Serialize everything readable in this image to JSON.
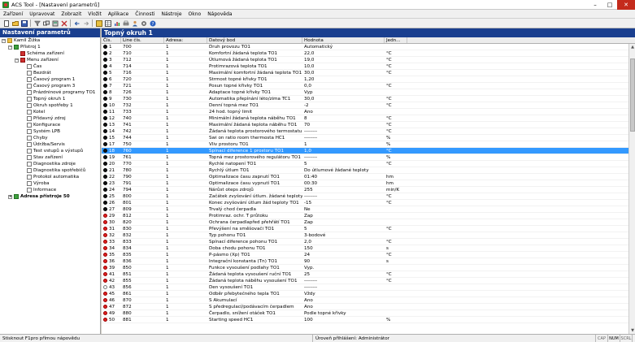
{
  "window": {
    "title": "ACS Tool - [Nastavení parametrů]",
    "minimize": "–",
    "maximize": "□",
    "close": "✕"
  },
  "menu": [
    "Zařízení",
    "Upravovat",
    "Zobrazit",
    "Vložit",
    "Aplikace",
    "Činnosti",
    "Nástroje",
    "Okno",
    "Nápověda"
  ],
  "left": {
    "header": "Nastavení parametrů",
    "tree": [
      {
        "label": "Kamil Žižka",
        "level": 0,
        "expander": "−",
        "icon": "folder"
      },
      {
        "label": "Přístroj 1",
        "level": 1,
        "expander": "−",
        "icon": "green"
      },
      {
        "label": "Schéma zařízení",
        "level": 2,
        "expander": "",
        "icon": "red"
      },
      {
        "label": "Menu zařízení",
        "level": 2,
        "expander": "−",
        "icon": "red"
      },
      {
        "label": "Čas",
        "level": 3,
        "expander": "",
        "icon": "white"
      },
      {
        "label": "Bezdrát",
        "level": 3,
        "expander": "",
        "icon": "white"
      },
      {
        "label": "Časový program 1",
        "level": 3,
        "expander": "",
        "icon": "white"
      },
      {
        "label": "Časový program 3",
        "level": 3,
        "expander": "",
        "icon": "white"
      },
      {
        "label": "Prázdninové programy TO1",
        "level": 3,
        "expander": "",
        "icon": "white"
      },
      {
        "label": "Topný okruh 1",
        "level": 3,
        "expander": "",
        "icon": "white"
      },
      {
        "label": "Okruh spotřeby 1",
        "level": 3,
        "expander": "",
        "icon": "white"
      },
      {
        "label": "Kotel",
        "level": 3,
        "expander": "",
        "icon": "white"
      },
      {
        "label": "Přídavný zdroj",
        "level": 3,
        "expander": "",
        "icon": "white"
      },
      {
        "label": "Konfigurace",
        "level": 3,
        "expander": "",
        "icon": "white"
      },
      {
        "label": "Systém LPB",
        "level": 3,
        "expander": "",
        "icon": "white"
      },
      {
        "label": "Chyby",
        "level": 3,
        "expander": "",
        "icon": "white"
      },
      {
        "label": "Údržba/Servis",
        "level": 3,
        "expander": "",
        "icon": "white"
      },
      {
        "label": "Test vstupů a výstupů",
        "level": 3,
        "expander": "",
        "icon": "white"
      },
      {
        "label": "Stav zařízení",
        "level": 3,
        "expander": "",
        "icon": "white"
      },
      {
        "label": "Diagnostika zdroje",
        "level": 3,
        "expander": "",
        "icon": "white"
      },
      {
        "label": "Diagnostika spotřebičů",
        "level": 3,
        "expander": "",
        "icon": "white"
      },
      {
        "label": "Protokol automatika",
        "level": 3,
        "expander": "",
        "icon": "white"
      },
      {
        "label": "Výroba",
        "level": 3,
        "expander": "",
        "icon": "white"
      },
      {
        "label": "Informace",
        "level": 3,
        "expander": "",
        "icon": "white"
      },
      {
        "label": "Adresa přístroje 50",
        "level": 1,
        "expander": "+",
        "icon": "green",
        "bold": true
      }
    ]
  },
  "right": {
    "header": "Topný okruh 1",
    "columns": [
      "Čís.",
      "Line čís.",
      "Adresa:",
      "Datový bod",
      "Hodnota",
      "Jedn..."
    ],
    "rows": [
      {
        "n": "1",
        "line": "700",
        "addr": "1",
        "name": "Druh provozu TO1",
        "value": "Automatický",
        "unit": "",
        "dot": "black"
      },
      {
        "n": "2",
        "line": "710",
        "addr": "1",
        "name": "Komfortní žádaná teplota TO1",
        "value": "22,0",
        "unit": "°C",
        "dot": "black"
      },
      {
        "n": "3",
        "line": "712",
        "addr": "1",
        "name": "Útlumová žádaná teplota TO1",
        "value": "19,0",
        "unit": "°C",
        "dot": "black"
      },
      {
        "n": "4",
        "line": "714",
        "addr": "1",
        "name": "Protimrazová teplota TO1",
        "value": "10,0",
        "unit": "°C",
        "dot": "black"
      },
      {
        "n": "5",
        "line": "716",
        "addr": "1",
        "name": "Maximální komfortní žádaná teplota TO1",
        "value": "30,0",
        "unit": "°C",
        "dot": "black"
      },
      {
        "n": "6",
        "line": "720",
        "addr": "1",
        "name": "Strmost topné křivky TO1",
        "value": "1,20",
        "unit": "",
        "dot": "black"
      },
      {
        "n": "7",
        "line": "721",
        "addr": "1",
        "name": "Posun topné křivky TO1",
        "value": "0,0",
        "unit": "°C",
        "dot": "black"
      },
      {
        "n": "8",
        "line": "726",
        "addr": "1",
        "name": "Adaptace topné křivky TO1",
        "value": "Vyp",
        "unit": "",
        "dot": "black"
      },
      {
        "n": "9",
        "line": "730",
        "addr": "1",
        "name": "Automatika přepínání léto/zima TC1",
        "value": "30,0",
        "unit": "°C",
        "dot": "black"
      },
      {
        "n": "10",
        "line": "732",
        "addr": "1",
        "name": "Denní topná mez TO1",
        "value": "-2",
        "unit": "°C",
        "dot": "black"
      },
      {
        "n": "11",
        "line": "733",
        "addr": "1",
        "name": "24 hod. topný limit",
        "value": "Ano",
        "unit": "",
        "dot": "black"
      },
      {
        "n": "12",
        "line": "740",
        "addr": "1",
        "name": "Minimální žádaná teplota náběhu TO1",
        "value": "8",
        "unit": "°C",
        "dot": "black"
      },
      {
        "n": "13",
        "line": "741",
        "addr": "1",
        "name": "Maximální žádaná teplota náběhu TO1",
        "value": "70",
        "unit": "°C",
        "dot": "black"
      },
      {
        "n": "14",
        "line": "742",
        "addr": "1",
        "name": "Žádaná teplota prostorového termostatu T...",
        "value": "--------",
        "unit": "°C",
        "dot": "black"
      },
      {
        "n": "15",
        "line": "744",
        "addr": "1",
        "name": "Swi on ratio room thermosta HC1",
        "value": "--------",
        "unit": "%",
        "dot": "black"
      },
      {
        "n": "17",
        "line": "750",
        "addr": "1",
        "name": "Vliv prostoru TO1",
        "value": "1",
        "unit": "%",
        "dot": "black"
      },
      {
        "n": "18",
        "line": "760",
        "addr": "1",
        "name": "Spínací diference 1 prostoru TO1",
        "value": "1,0",
        "unit": "°C",
        "dot": "black",
        "selected": true
      },
      {
        "n": "19",
        "line": "761",
        "addr": "1",
        "name": "Topná mez prostorového regulátoru TO1",
        "value": "--------",
        "unit": "%",
        "dot": "black"
      },
      {
        "n": "20",
        "line": "770",
        "addr": "1",
        "name": "Rychlé natopení TO1",
        "value": "5",
        "unit": "°C",
        "dot": "black"
      },
      {
        "n": "21",
        "line": "780",
        "addr": "1",
        "name": "Rychlý útlum TO1",
        "value": "Do útlumové žádané teploty",
        "unit": "",
        "dot": "black"
      },
      {
        "n": "22",
        "line": "790",
        "addr": "1",
        "name": "Optimalizace času zapnutí TO1",
        "value": "01:40",
        "unit": "hm",
        "dot": "black"
      },
      {
        "n": "23",
        "line": "791",
        "addr": "1",
        "name": "Optimalizace času vypnutí TO1",
        "value": "00:30",
        "unit": "hm",
        "dot": "black"
      },
      {
        "n": "24",
        "line": "794",
        "addr": "1",
        "name": "Nárůst oteps zdrojů",
        "value": "255",
        "unit": "min/K",
        "dot": "black"
      },
      {
        "n": "25",
        "line": "800",
        "addr": "1",
        "name": "Začátek zvyšování útlum. žádané teploty TC1",
        "value": "--------",
        "unit": "°C",
        "dot": "black"
      },
      {
        "n": "26",
        "line": "801",
        "addr": "1",
        "name": "Konec zvyšování útlum žád teploty TO1",
        "value": "-15",
        "unit": "°C",
        "dot": "black"
      },
      {
        "n": "27",
        "line": "809",
        "addr": "1",
        "name": "Trvalý chod čerpadla",
        "value": "Ne",
        "unit": "",
        "dot": "black"
      },
      {
        "n": "29",
        "line": "812",
        "addr": "1",
        "name": "Protimraz. ochr. T průtoku",
        "value": "Zap",
        "unit": "",
        "dot": "red"
      },
      {
        "n": "30",
        "line": "820",
        "addr": "1",
        "name": "Ochrana čerpadlapřed přehřátí TO1",
        "value": "Zap",
        "unit": "",
        "dot": "red"
      },
      {
        "n": "31",
        "line": "830",
        "addr": "1",
        "name": "Převýšení na směšovači TO1",
        "value": "5",
        "unit": "°C",
        "dot": "red"
      },
      {
        "n": "32",
        "line": "832",
        "addr": "1",
        "name": "Typ pohonu TO1",
        "value": "3-bodové",
        "unit": "",
        "dot": "red"
      },
      {
        "n": "33",
        "line": "833",
        "addr": "1",
        "name": "Spínací diference pohonu TO1",
        "value": "2,0",
        "unit": "°C",
        "dot": "red"
      },
      {
        "n": "34",
        "line": "834",
        "addr": "1",
        "name": "Doba chodu pohonu TO1",
        "value": "150",
        "unit": "s",
        "dot": "red"
      },
      {
        "n": "35",
        "line": "835",
        "addr": "1",
        "name": "P-pásmo (Xp) TO1",
        "value": "24",
        "unit": "°C",
        "dot": "red"
      },
      {
        "n": "36",
        "line": "836",
        "addr": "1",
        "name": "Integrační konstanta (Tn) TO1",
        "value": "90",
        "unit": "s",
        "dot": "red"
      },
      {
        "n": "39",
        "line": "850",
        "addr": "1",
        "name": "Funkce vysoušení podlahy TO1",
        "value": "Vyp.",
        "unit": "",
        "dot": "red"
      },
      {
        "n": "41",
        "line": "851",
        "addr": "1",
        "name": "Žádaná teplota vysoušení ruční TO1",
        "value": "25",
        "unit": "°C",
        "dot": "red"
      },
      {
        "n": "42",
        "line": "855",
        "addr": "1",
        "name": "Žádaná teplota náběhu vysoušení TO1",
        "value": "--------",
        "unit": "°C",
        "dot": "red"
      },
      {
        "n": "43",
        "line": "856",
        "addr": "1",
        "name": "Den vysoušení TO1",
        "value": "--------",
        "unit": "",
        "dot": "white"
      },
      {
        "n": "45",
        "line": "861",
        "addr": "1",
        "name": "Odběr přebytečného tepla TO1",
        "value": "Vždy",
        "unit": "",
        "dot": "red"
      },
      {
        "n": "46",
        "line": "870",
        "addr": "1",
        "name": "S Akumulací",
        "value": "Ano",
        "unit": "",
        "dot": "red"
      },
      {
        "n": "47",
        "line": "872",
        "addr": "1",
        "name": "S předregulací/podávacím čerpadlem",
        "value": "Ano",
        "unit": "",
        "dot": "red"
      },
      {
        "n": "49",
        "line": "880",
        "addr": "1",
        "name": "Čerpadlo, snížení otáček TO1",
        "value": "Podle topné křivky",
        "unit": "",
        "dot": "red"
      },
      {
        "n": "50",
        "line": "881",
        "addr": "1",
        "name": "Starting speed HC1",
        "value": "100",
        "unit": "%",
        "dot": "red"
      }
    ]
  },
  "status": {
    "help": "Stisknout F1pro přímou nápovědu",
    "level": "Úroveň přihlášení: Administrátor",
    "indicators": [
      "CAP",
      "NUM",
      "SCRL"
    ]
  },
  "colors": {
    "header_blue": "#1a3f8f",
    "selection": "#3399ff",
    "close_red": "#c42b1c"
  }
}
